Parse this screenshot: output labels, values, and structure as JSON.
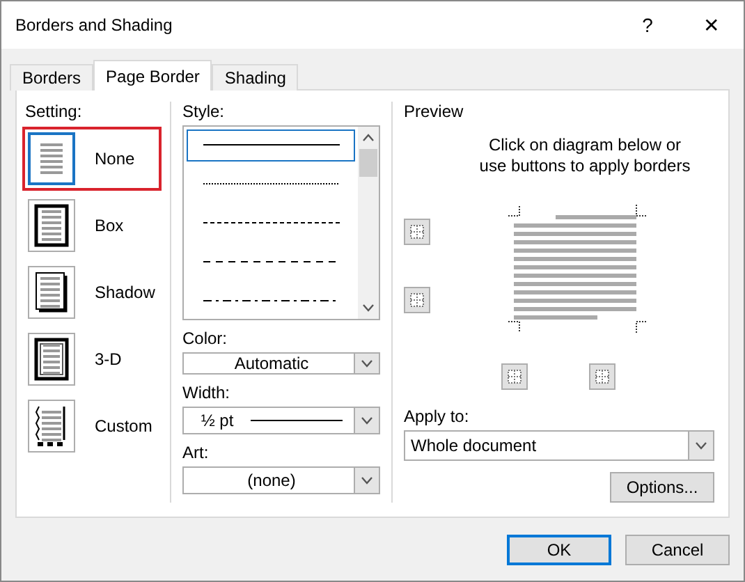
{
  "window": {
    "title": "Borders and Shading",
    "help": "?",
    "close": "✕"
  },
  "tabs": [
    {
      "label": "Borders",
      "selected": false
    },
    {
      "label": "Page Border",
      "selected": true
    },
    {
      "label": "Shading",
      "selected": false
    }
  ],
  "setting": {
    "label": "Setting:",
    "items": [
      {
        "kind": "none",
        "label": "None",
        "selected": true,
        "highlighted": true
      },
      {
        "kind": "box",
        "label": "Box",
        "selected": false,
        "highlighted": false
      },
      {
        "kind": "shadow",
        "label": "Shadow",
        "selected": false,
        "highlighted": false
      },
      {
        "kind": "framed",
        "label": "3-D",
        "selected": false,
        "highlighted": false
      },
      {
        "kind": "custom",
        "label": "Custom",
        "selected": false,
        "highlighted": false
      }
    ]
  },
  "style": {
    "label": "Style:",
    "items": [
      {
        "kind": "solid",
        "selected": true
      },
      {
        "kind": "dotted",
        "selected": false
      },
      {
        "kind": "dashed-small",
        "selected": false
      },
      {
        "kind": "dashed",
        "selected": false
      },
      {
        "kind": "dash-dot",
        "selected": false
      }
    ]
  },
  "color": {
    "label": "Color:",
    "value": "Automatic"
  },
  "width": {
    "label": "Width:",
    "value": "½ pt"
  },
  "art": {
    "label": "Art:",
    "value": "(none)"
  },
  "preview": {
    "label": "Preview",
    "hint": "Click on diagram below or use buttons to apply borders"
  },
  "apply_to": {
    "label": "Apply to:",
    "value": "Whole document"
  },
  "buttons": [
    {
      "kind": "options",
      "label": "Options..."
    },
    {
      "kind": "ok",
      "label": "OK"
    },
    {
      "kind": "cancel",
      "label": "Cancel"
    }
  ]
}
